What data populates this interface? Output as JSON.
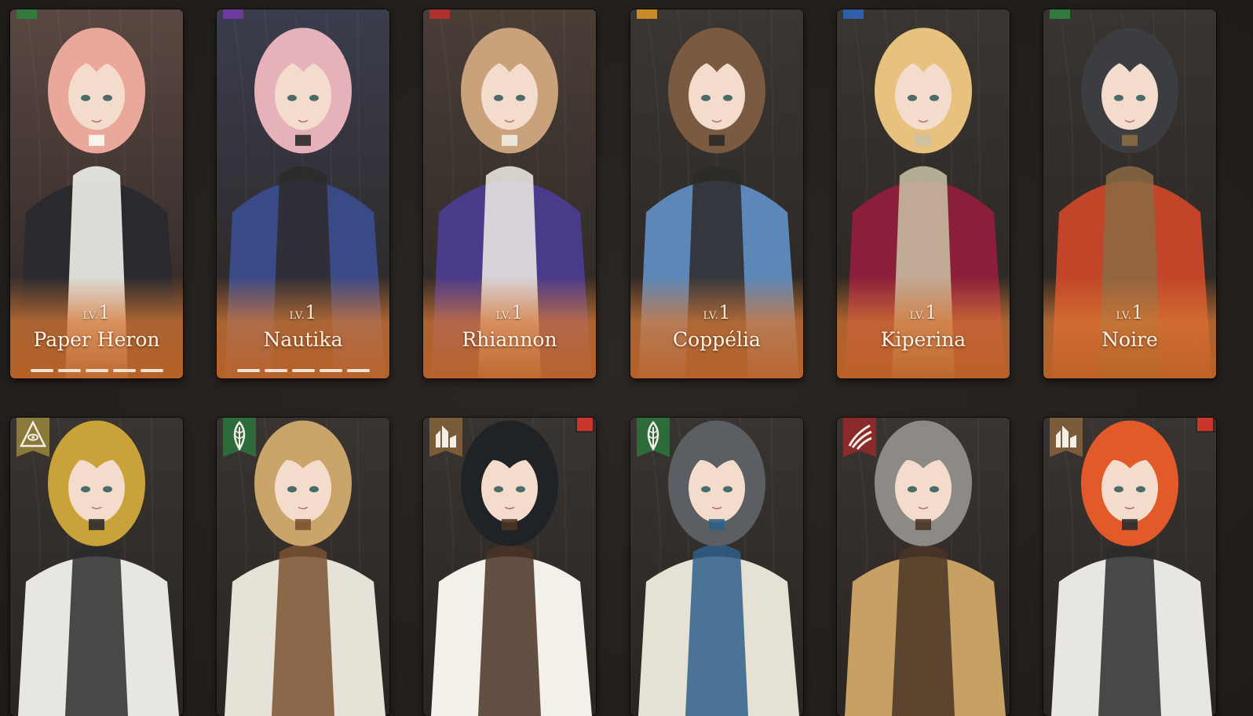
{
  "row1": [
    {
      "name": "Paper Heron",
      "lv_label": "LV.",
      "lv_value": "1",
      "pips": 5,
      "flag_color": "#2f7a3c",
      "palette": [
        "#5b4742",
        "#e9a899",
        "#2a2a2e",
        "#fbfbf7"
      ]
    },
    {
      "name": "Nautika",
      "lv_label": "LV.",
      "lv_value": "1",
      "pips": 5,
      "flag_color": "#6d3aa0",
      "palette": [
        "#3b3d4d",
        "#e6b2b9",
        "#3a4a86",
        "#2d2a2a"
      ]
    },
    {
      "name": "Rhiannon",
      "lv_label": "LV.",
      "lv_value": "1",
      "pips": 0,
      "flag_color": "#b03030",
      "palette": [
        "#4a3e37",
        "#c9a17a",
        "#4a3a8a",
        "#f1ede6"
      ]
    },
    {
      "name": "Coppélia",
      "lv_label": "LV.",
      "lv_value": "1",
      "pips": 0,
      "flag_color": "#c98b2a",
      "palette": [
        "#3b3632",
        "#7b5a42",
        "#5c87b8",
        "#2d2a28"
      ]
    },
    {
      "name": "Kiperina",
      "lv_label": "LV.",
      "lv_value": "1",
      "pips": 0,
      "flag_color": "#2f5fa8",
      "palette": [
        "#3a3530",
        "#e6c27e",
        "#8b1f3a",
        "#c9c2a6"
      ]
    },
    {
      "name": "Noire",
      "lv_label": "LV.",
      "lv_value": "1",
      "pips": 0,
      "flag_color": "#2f7a3c",
      "palette": [
        "#3a3431",
        "#3b3d40",
        "#c24529",
        "#8a6a43"
      ]
    }
  ],
  "row2": [
    {
      "badge": "eye-pyramid-icon",
      "badge_color": "#8a7a3a",
      "corner_flag": false,
      "palette": [
        "#3a3431",
        "#c9a33a",
        "#e8e6e3",
        "#2b2b2b"
      ]
    },
    {
      "badge": "leaf-icon",
      "badge_color": "#2e6b3a",
      "corner_flag": false,
      "palette": [
        "#3a3431",
        "#c9a56b",
        "#e7e2d8",
        "#7a5230"
      ]
    },
    {
      "badge": "ruins-icon",
      "badge_color": "#7a5c3a",
      "corner_flag": true,
      "palette": [
        "#3a3431",
        "#1f2326",
        "#f3f0ea",
        "#4a3326"
      ]
    },
    {
      "badge": "leaf-icon",
      "badge_color": "#2e6b3a",
      "corner_flag": false,
      "palette": [
        "#3a3431",
        "#5b5e62",
        "#e6e1d5",
        "#2f5f8a"
      ]
    },
    {
      "badge": "claw-icon",
      "badge_color": "#8a2a2a",
      "corner_flag": false,
      "palette": [
        "#3a3431",
        "#8d8a86",
        "#c7a064",
        "#4a3426"
      ]
    },
    {
      "badge": "ruins-icon",
      "badge_color": "#7a5c3a",
      "corner_flag": true,
      "palette": [
        "#3a3431",
        "#e25a2a",
        "#e8e6e3",
        "#2b2b2b"
      ]
    }
  ]
}
